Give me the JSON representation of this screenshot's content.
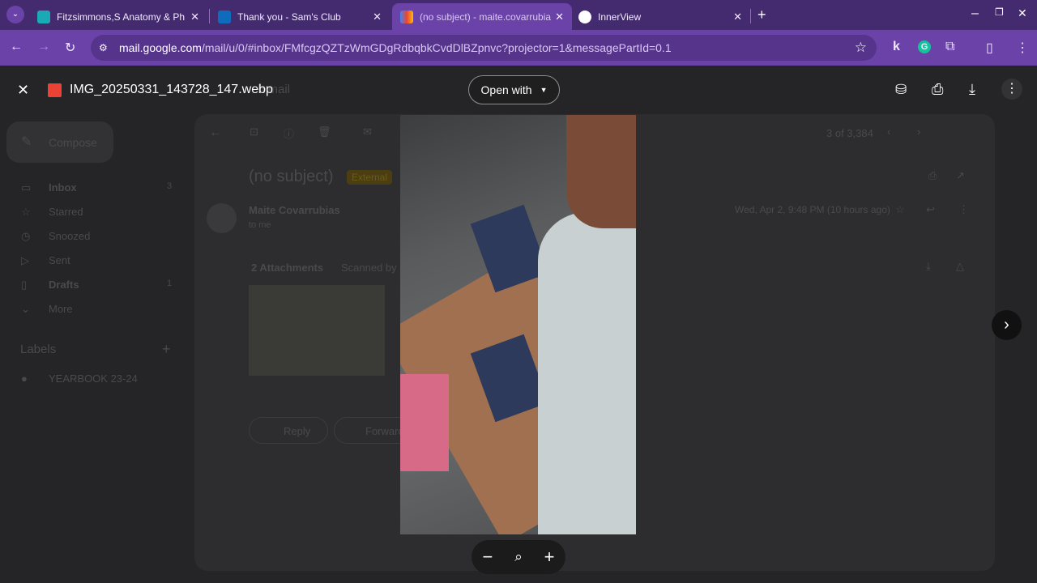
{
  "browser": {
    "tabs": [
      {
        "title": "Fitzsimmons,S Anatomy & Ph",
        "color": "#1ba9b5"
      },
      {
        "title": "Thank you - Sam's Club",
        "color": "#0f6cbd"
      },
      {
        "title": "(no subject) - maite.covarrubia",
        "color": "#ea4335",
        "active": true
      },
      {
        "title": "InnerView",
        "color": "#ffffff"
      }
    ],
    "new_tab": "+",
    "url_host": "mail.google.com",
    "url_path": "/mail/u/0/#inbox/FMfcgzQZTzWmGDgRdbqbkCvdDlBZpnvc?projector=1&messagePartId=0.1",
    "extension_k": "k",
    "extension_g": "G"
  },
  "gmail": {
    "search_partial": "h mail",
    "compose": "Compose",
    "nav": [
      {
        "label": "Inbox",
        "count": "3"
      },
      {
        "label": "Starred",
        "count": ""
      },
      {
        "label": "Snoozed",
        "count": ""
      },
      {
        "label": "Sent",
        "count": ""
      },
      {
        "label": "Drafts",
        "count": "1"
      },
      {
        "label": "More",
        "count": ""
      }
    ],
    "labels_title": "Labels",
    "labels": [
      "YEARBOOK 23-24"
    ],
    "pager": "3 of 3,384",
    "subject": "(no subject)",
    "badge": "External",
    "sender": "Maite Covarrubias",
    "to": "to me",
    "date": "Wed, Apr 2, 9:48 PM (10 hours ago)",
    "attachments": "2 Attachments",
    "scanned": "Scanned by",
    "reply": "Reply",
    "forward": "Forward"
  },
  "viewer": {
    "filename": "IMG_20250331_143728_147.webp",
    "open_with": "Open with",
    "zoom_out": "−",
    "zoom_in": "+",
    "next": "›"
  }
}
